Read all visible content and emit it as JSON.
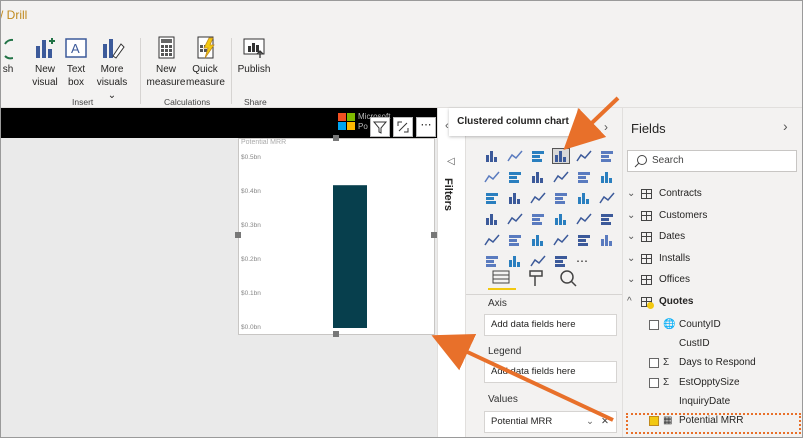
{
  "ribbon": {
    "tab_fragment": "/ Drill",
    "buttons": {
      "publish_fragment": "sh",
      "new_visual": [
        "New",
        "visual"
      ],
      "text_box": [
        "Text",
        "box"
      ],
      "more_visuals": [
        "More",
        "visuals ⌄"
      ],
      "new_measure": [
        "New",
        "measure"
      ],
      "quick_measure": [
        "Quick",
        "measure"
      ],
      "publish": [
        "Publish",
        ""
      ]
    },
    "groups": {
      "insert": "Insert",
      "calculations": "Calculations",
      "share": "Share"
    }
  },
  "canvas": {
    "logo_text": [
      "Microsoft",
      "Po"
    ],
    "visual_title": "Potential MRR",
    "y_ticks": [
      "$0.5bn",
      "$0.4bn",
      "$0.3bn",
      "$0.2bn",
      "$0.1bn",
      "$0.0bn"
    ]
  },
  "chart_data": {
    "type": "bar",
    "categories": [
      ""
    ],
    "values": [
      0.42
    ],
    "title": "Potential MRR",
    "ylabel": "",
    "ylim": [
      0,
      0.5
    ],
    "bar_color": "#073f4d"
  },
  "filters": {
    "label": "Filters"
  },
  "visualizations": {
    "tooltip": "Clustered column chart",
    "wells": [
      {
        "label": "Axis",
        "placeholder": "Add data fields here"
      },
      {
        "label": "Legend",
        "placeholder": "Add data fields here"
      },
      {
        "label": "Values",
        "value": "Potential MRR"
      }
    ]
  },
  "fields": {
    "title": "Fields",
    "search_placeholder": "Search",
    "tables": [
      "Contracts",
      "Customers",
      "Dates",
      "Installs",
      "Offices"
    ],
    "expanded_table": "Quotes",
    "quote_fields": [
      {
        "name": "CountyID",
        "icon": "globe-icon",
        "checkbox": true
      },
      {
        "name": "CustID",
        "icon": "",
        "checkbox": false
      },
      {
        "name": "Days to Respond",
        "icon": "sigma-icon",
        "checkbox": true
      },
      {
        "name": "EstOpptySize",
        "icon": "sigma-icon",
        "checkbox": true
      },
      {
        "name": "InquiryDate",
        "icon": "",
        "checkbox": false
      },
      {
        "name": "Potential MRR",
        "icon": "calculator-icon",
        "checkbox": true,
        "checked": true
      }
    ]
  },
  "colors": {
    "accent": "#f2c811",
    "arrow": "#e8702a",
    "highlight_border": "#e8702a"
  }
}
